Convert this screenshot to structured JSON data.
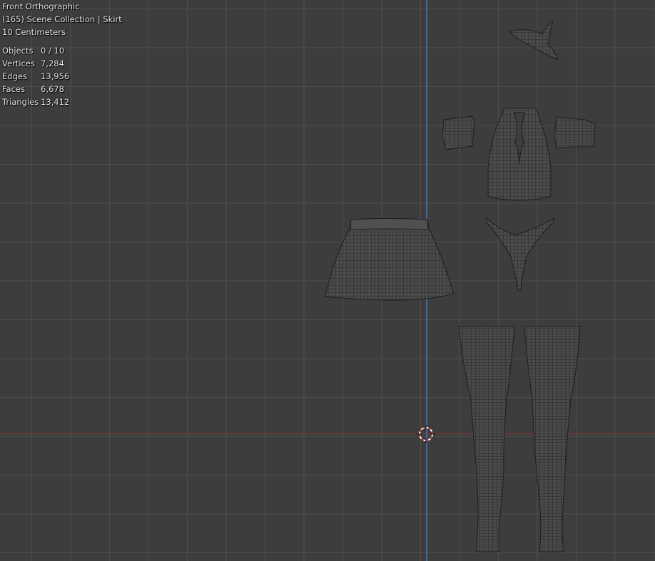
{
  "viewport": {
    "view_name": "Front Orthographic",
    "collection_info": "(165) Scene Collection | Skirt",
    "grid_scale": "10 Centimeters",
    "colors": {
      "background": "#3d3d3d",
      "grid": "#505050",
      "x_axis": "#8a3a3a",
      "z_axis": "#3f6ea6",
      "wire": "#1e1e1e"
    }
  },
  "stats": [
    {
      "label": "Objects",
      "value": "0 / 10"
    },
    {
      "label": "Vertices",
      "value": "7,284"
    },
    {
      "label": "Edges",
      "value": "13,956"
    },
    {
      "label": "Faces",
      "value": "6,678"
    },
    {
      "label": "Triangles",
      "value": "13,412"
    }
  ],
  "icons": {
    "cursor": "3d-cursor-icon"
  }
}
